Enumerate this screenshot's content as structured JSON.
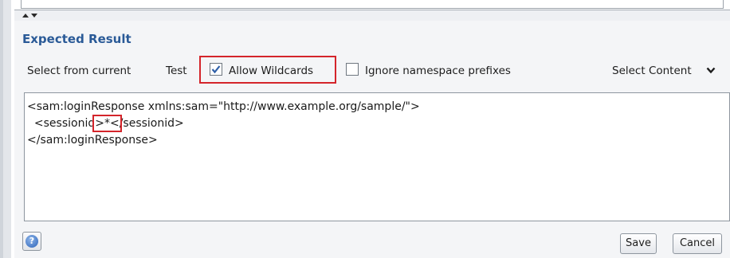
{
  "section": {
    "title": "Expected Result"
  },
  "toolbar": {
    "select_from_current": "Select from current",
    "test": "Test",
    "allow_wildcards": {
      "label": "Allow Wildcards",
      "checked": true
    },
    "ignore_namespace": {
      "label": "Ignore namespace prefixes",
      "checked": false
    },
    "select_content": "Select Content"
  },
  "editor": {
    "lines": [
      "<sam:loginResponse xmlns:sam=\"http://www.example.org/sample/\">",
      "  <sessionid>*</sessionid>",
      "</sam:loginResponse>"
    ],
    "line2_prefix": "  <sessionid",
    "line2_wildcard": ">*<",
    "line2_suffix": "/sessionid>"
  },
  "footer": {
    "help_icon": "help-icon",
    "help_glyph": "?",
    "save": "Save",
    "cancel": "Cancel"
  },
  "colors": {
    "accent": "#2a5a97",
    "highlight": "#d4252b"
  }
}
